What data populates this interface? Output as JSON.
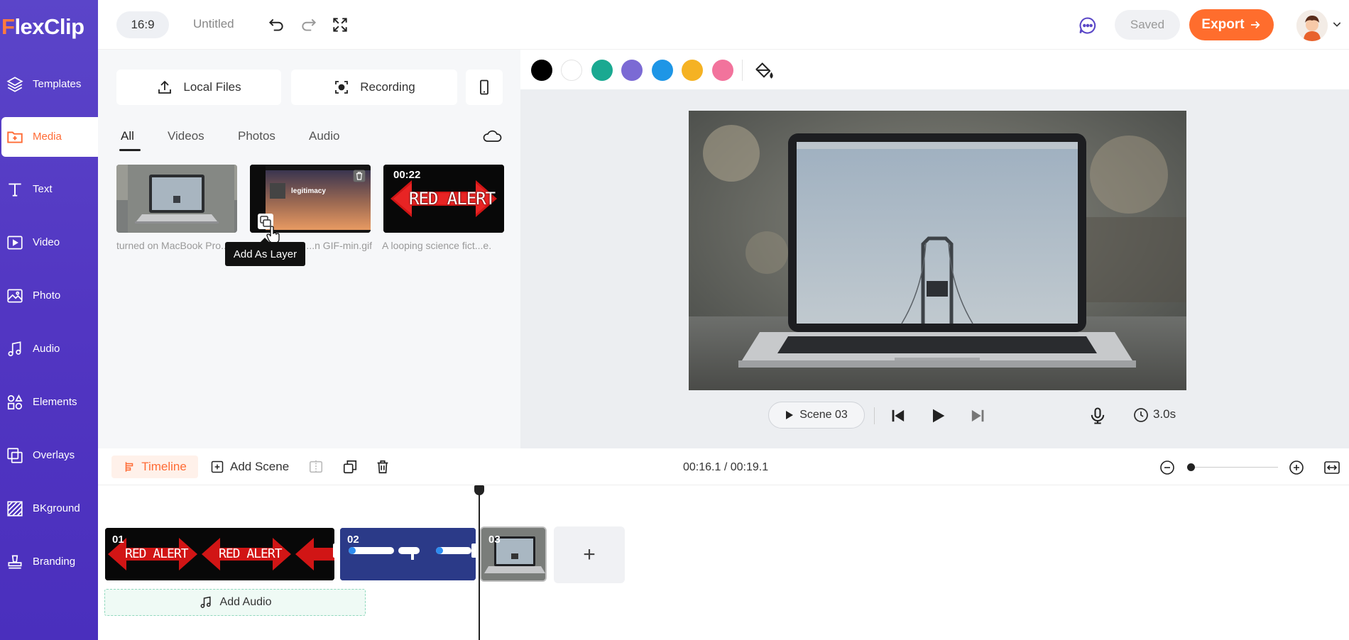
{
  "app": {
    "logo": "FlexClip",
    "logo_first": "F",
    "logo_rest": "lexClip"
  },
  "sidebar": {
    "items": [
      {
        "label": "Templates",
        "icon": "layers-icon"
      },
      {
        "label": "Media",
        "icon": "media-folder-icon",
        "active": true
      },
      {
        "label": "Text",
        "icon": "text-icon"
      },
      {
        "label": "Video",
        "icon": "video-icon"
      },
      {
        "label": "Photo",
        "icon": "photo-icon"
      },
      {
        "label": "Audio",
        "icon": "music-icon"
      },
      {
        "label": "Elements",
        "icon": "elements-icon"
      },
      {
        "label": "Overlays",
        "icon": "overlays-icon"
      },
      {
        "label": "BKground",
        "icon": "background-icon"
      },
      {
        "label": "Branding",
        "icon": "stamp-icon"
      }
    ]
  },
  "topbar": {
    "ratio": "16:9",
    "project_title": "Untitled",
    "saved_label": "Saved",
    "export_label": "Export"
  },
  "media_panel": {
    "local_files_label": "Local Files",
    "recording_label": "Recording",
    "tabs": [
      "All",
      "Videos",
      "Photos",
      "Audio"
    ],
    "active_tab": "All",
    "items": [
      {
        "caption": "turned on MacBook Pro..."
      },
      {
        "caption": "...n GIF-min.gif",
        "text": "legitimacy"
      },
      {
        "caption": "A looping science fict...e.",
        "duration": "00:22",
        "text": "RED ALERT"
      }
    ],
    "tooltip": "Add As Layer"
  },
  "color_bar": {
    "swatches": [
      "#000000",
      "#ffffff",
      "#1aa991",
      "#7b6ad4",
      "#1e96e6",
      "#f5b223",
      "#f2739c"
    ]
  },
  "preview": {
    "scene_label": "Scene 03",
    "duration": "3.0s"
  },
  "timeline": {
    "timeline_label": "Timeline",
    "add_scene_label": "Add Scene",
    "time_display": "00:16.1 / 00:19.1",
    "clips": [
      {
        "number": "01",
        "text": "RED ALERT"
      },
      {
        "number": "02"
      },
      {
        "number": "03"
      }
    ],
    "add_clip_label": "+",
    "add_audio_label": "Add Audio"
  },
  "colors": {
    "accent": "#ff6d2d",
    "sidebar": "#5236c2"
  }
}
